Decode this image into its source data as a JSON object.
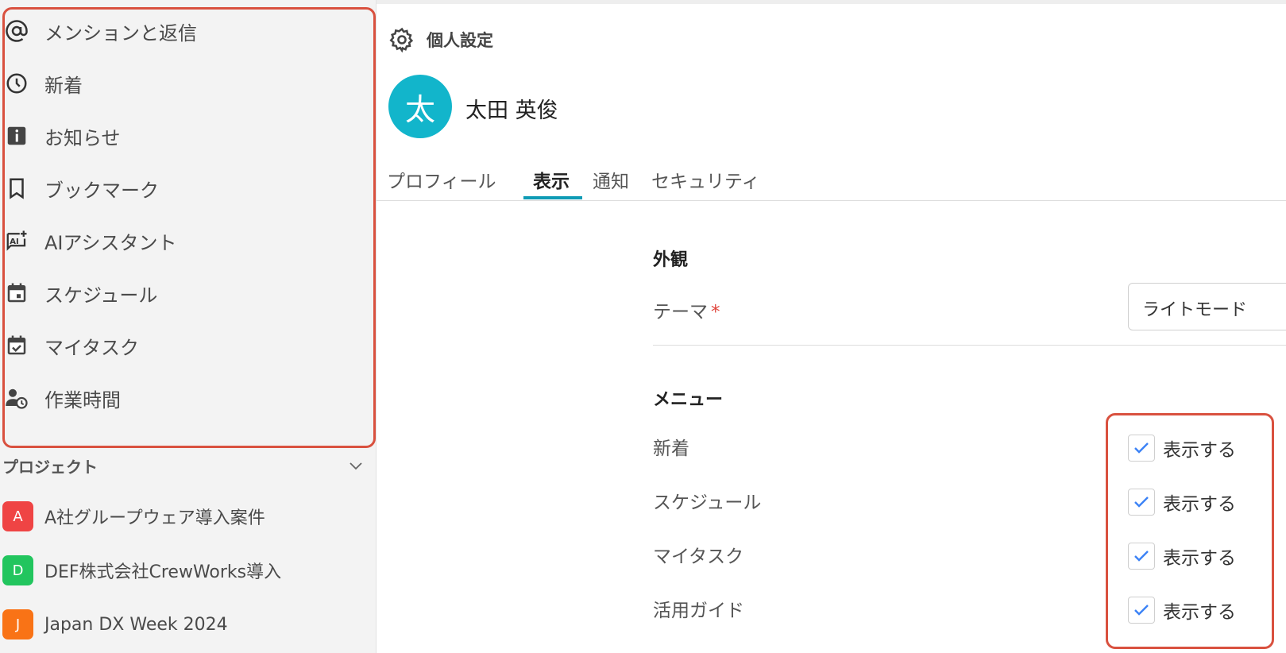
{
  "sidebar": {
    "nav_items": [
      {
        "label": "メンションと返信",
        "icon": "at-sign-icon"
      },
      {
        "label": "新着",
        "icon": "clock-icon"
      },
      {
        "label": "お知らせ",
        "icon": "info-icon"
      },
      {
        "label": "ブックマーク",
        "icon": "bookmark-icon"
      },
      {
        "label": "AIアシスタント",
        "icon": "ai-assistant-icon"
      },
      {
        "label": "スケジュール",
        "icon": "calendar-icon"
      },
      {
        "label": "マイタスク",
        "icon": "calendar-check-icon"
      },
      {
        "label": "作業時間",
        "icon": "person-clock-icon"
      }
    ],
    "projects_title": "プロジェクト",
    "projects": [
      {
        "badge": "A",
        "label": "A社グループウェア導入案件",
        "color": "#ef4444"
      },
      {
        "badge": "D",
        "label": "DEF株式会社CrewWorks導入",
        "color": "#22c55e"
      },
      {
        "badge": "J",
        "label": "Japan DX Week 2024",
        "color": "#f97316"
      }
    ]
  },
  "settings": {
    "title": "個人設定",
    "avatar_initial": "太",
    "user_name": "太田 英俊",
    "tabs": [
      {
        "label": "プロフィール"
      },
      {
        "label": "表示"
      },
      {
        "label": "通知"
      },
      {
        "label": "セキュリティ"
      }
    ],
    "active_tab": "表示",
    "appearance": {
      "title": "外観",
      "theme_label": "テーマ",
      "required_mark": "*",
      "theme_value": "ライトモード"
    },
    "menu": {
      "title": "メニュー",
      "rows": [
        {
          "label": "新着",
          "checkbox_label": "表示する",
          "checked": true
        },
        {
          "label": "スケジュール",
          "checkbox_label": "表示する",
          "checked": true
        },
        {
          "label": "マイタスク",
          "checkbox_label": "表示する",
          "checked": true
        },
        {
          "label": "活用ガイド",
          "checkbox_label": "表示する",
          "checked": true
        }
      ]
    }
  },
  "colors": {
    "accent": "#0f9bb5",
    "highlight": "#d9513f",
    "avatar": "#12b5cb",
    "check": "#3b82f6"
  }
}
